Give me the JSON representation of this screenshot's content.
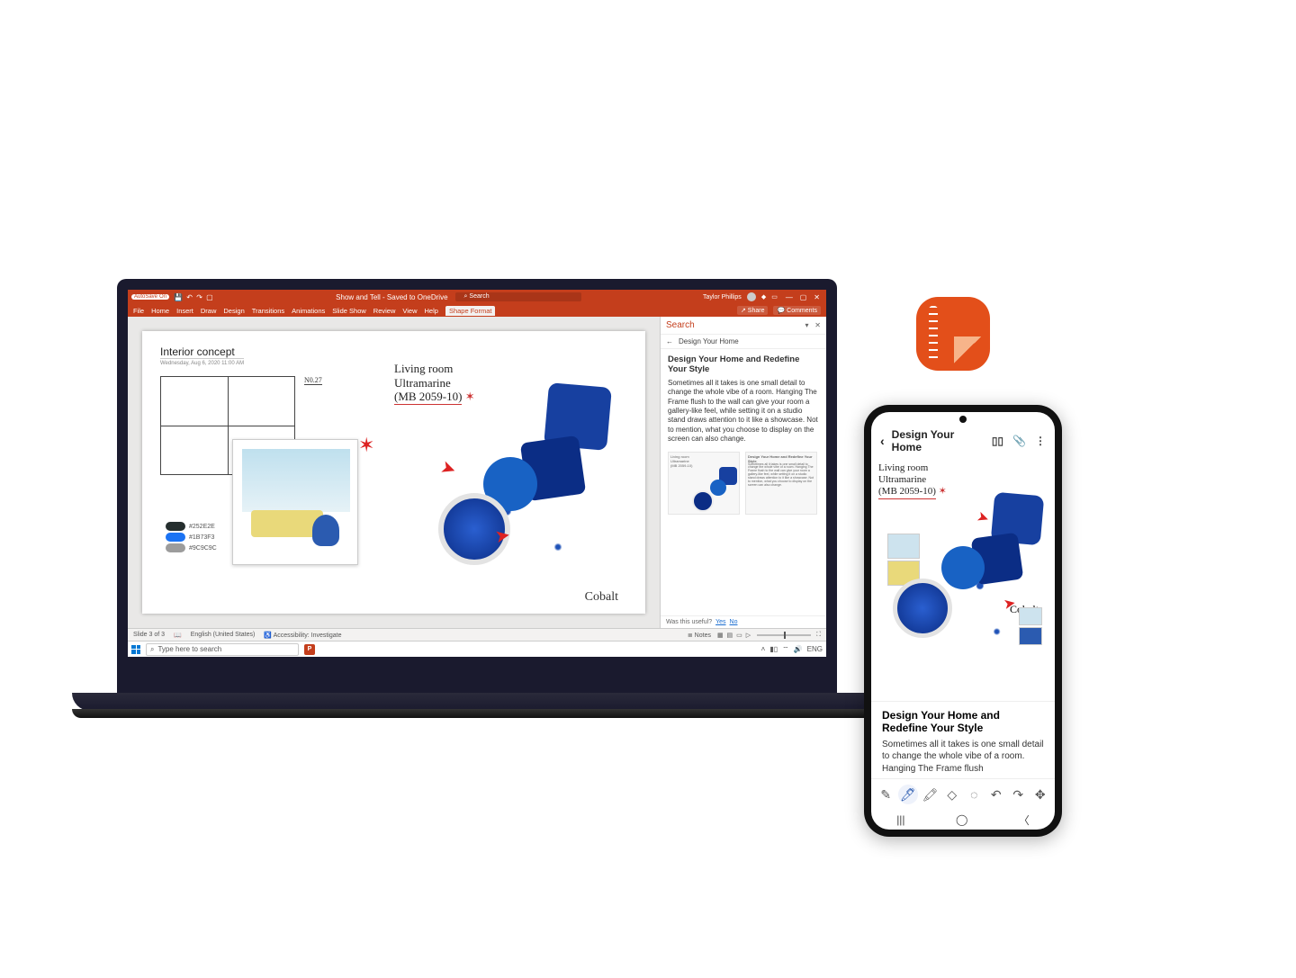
{
  "laptop": {
    "ppt": {
      "titlebar": {
        "autosave_label": "AutoSave",
        "autosave_state": "On",
        "doc_title": "Show and Tell - Saved to OneDrive",
        "search_placeholder": "Search",
        "user_name": "Taylor Phillips"
      },
      "tabs": {
        "file": "File",
        "home": "Home",
        "insert": "Insert",
        "draw": "Draw",
        "design": "Design",
        "transitions": "Transitions",
        "animations": "Animations",
        "slide_show": "Slide Show",
        "review": "Review",
        "view": "View",
        "help": "Help",
        "shape_format": "Shape Format",
        "share": "Share",
        "comments": "Comments"
      },
      "slide": {
        "title": "Interior concept",
        "subtitle": "Wednesday, Aug 6, 2020    11:00 AM",
        "annot_no": "N0.27",
        "hand_line1": "Living room",
        "hand_line2": "Ultramarine",
        "hand_line3": "(MB 2059-10)",
        "hand_line3_mark": "✶",
        "cobalt": "Cobalt",
        "swatches": [
          {
            "hex": "#252E2E",
            "label": "#252E2E"
          },
          {
            "hex": "#1B73F3",
            "label": "#1B73F3"
          },
          {
            "hex": "#9C9C9C",
            "label": "#9C9C9C"
          }
        ]
      },
      "search_panel": {
        "header": "Search",
        "query": "Design Your Home",
        "article_title": "Design Your Home and Redefine Your Style",
        "article_body": "Sometimes all it takes is one small detail to change the whole vibe of a room. Hanging The Frame flush to the wall can give your room a gallery-like feel, while setting it on a studio stand draws attention to it like a showcase. Not to mention, what you choose to display on the screen can also change.",
        "thumb_lines": {
          "l1": "Living room",
          "l2": "Ultramarine",
          "l3": "(MB 2059-10)"
        },
        "thumb_article_body": "Sometimes all it takes is one small detail to change the whole vibe of a room. Hanging The Frame flush to the wall can give your room a gallery-like feel, while setting it on a studio stand draws attention to it like a showcase. Not to mention, what you choose to display on the screen can also change.",
        "useful_label": "Was this useful?",
        "useful_yes": "Yes",
        "useful_no": "No"
      },
      "statusbar": {
        "slide_count": "Slide 3 of 3",
        "language": "English (United States)",
        "accessibility": "Accessibility: Investigate",
        "notes": "Notes"
      },
      "taskbar": {
        "search_placeholder": "Type here to search",
        "lang": "ENG"
      }
    }
  },
  "phone": {
    "notes": {
      "title": "Design Your Home",
      "hand_line1": "Living room",
      "hand_line2": "Ultramarine",
      "hand_line3": "(MB 2059-10)",
      "hand_line3_mark": "✶",
      "cobalt": "Cobalt",
      "article_title": "Design Your Home and Redefine Your Style",
      "article_body": "Sometimes all it takes is one small detail to change the whole vibe of a room. Hanging The Frame flush"
    }
  }
}
